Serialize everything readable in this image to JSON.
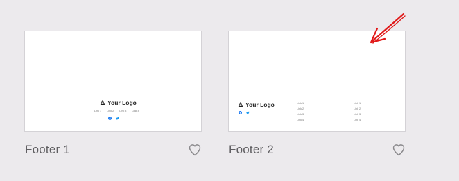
{
  "cards": [
    {
      "title": "Footer 1",
      "logo_text": "Your Logo",
      "links": [
        "Link 1",
        "Link 2",
        "Link 3",
        "Link 4"
      ],
      "social_icons": [
        "facebook-icon",
        "twitter-icon"
      ],
      "favorite_icon": "heart-outline-icon"
    },
    {
      "title": "Footer 2",
      "logo_text": "Your Logo",
      "social_icons": [
        "facebook-icon",
        "twitter-icon"
      ],
      "link_columns": [
        [
          "Link 1",
          "Link 2",
          "Link 3",
          "Link 4"
        ],
        [
          "Link 1",
          "Link 2",
          "Link 3",
          "Link 4"
        ]
      ],
      "favorite_icon": "heart-outline-icon"
    }
  ],
  "colors": {
    "background": "#eceaed",
    "card_border": "#d4d2d6",
    "social_blue": "#1877f2",
    "title_text": "#5f5e61",
    "heart_stroke": "#8a898c",
    "annotation_arrow": "#e11919"
  }
}
